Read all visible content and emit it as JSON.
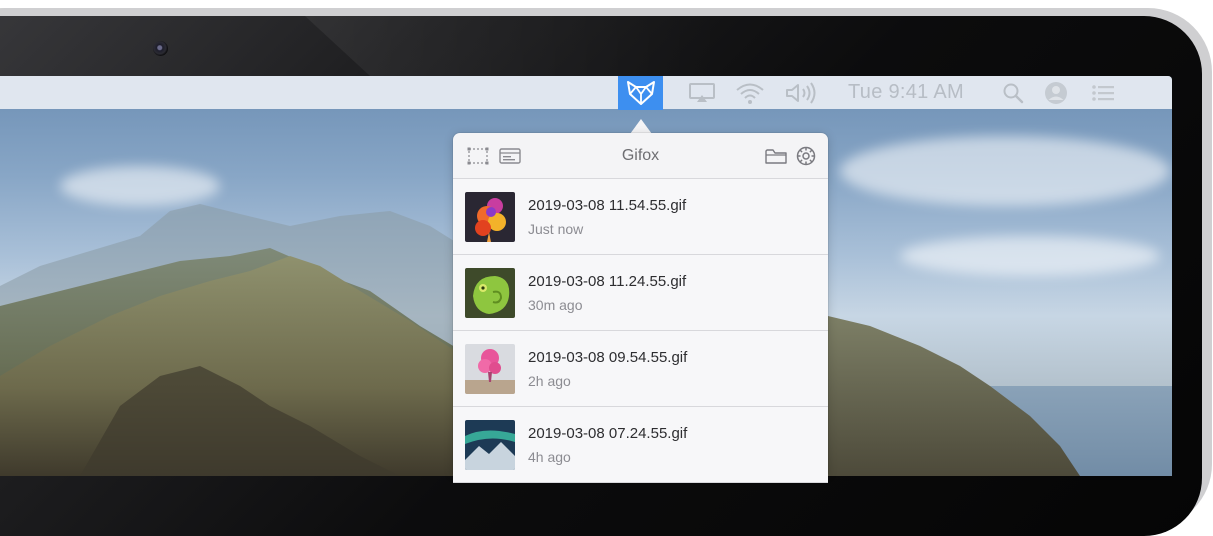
{
  "menubar": {
    "app_icon": "gifox-fox-icon",
    "airplay_icon": "airplay-icon",
    "wifi_icon": "wifi-icon",
    "volume_icon": "volume-icon",
    "clock": "Tue 9:41 AM",
    "search_icon": "spotlight-search-icon",
    "user_icon": "user-avatar-icon",
    "list_icon": "notification-list-icon",
    "accent_color": "#3d8ff0"
  },
  "popover": {
    "title": "Gifox",
    "header_icons": [
      "selection-capture-icon",
      "window-capture-icon",
      "folder-icon",
      "settings-gear-icon"
    ],
    "items": [
      {
        "filename": "2019-03-08 11.54.55.gif",
        "time": "Just now",
        "thumb": "colorful-smoke-thumbnail"
      },
      {
        "filename": "2019-03-08 11.24.55.gif",
        "time": "30m ago",
        "thumb": "chameleon-thumbnail"
      },
      {
        "filename": "2019-03-08 09.54.55.gif",
        "time": "2h ago",
        "thumb": "pink-smoke-thumbnail"
      },
      {
        "filename": "2019-03-08 07.24.55.gif",
        "time": "4h ago",
        "thumb": "aurora-mountain-thumbnail"
      }
    ]
  }
}
